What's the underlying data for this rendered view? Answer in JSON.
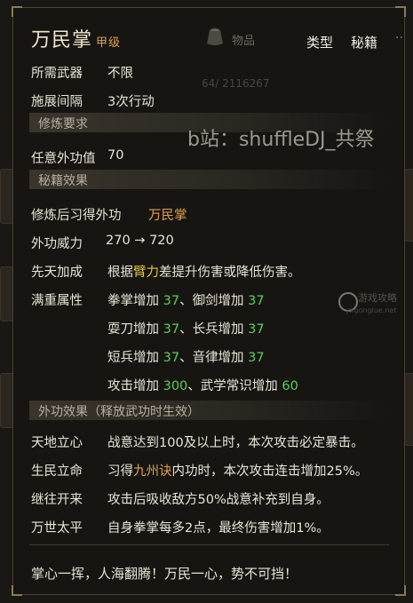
{
  "item": {
    "name": "万民掌",
    "grade": "甲级",
    "type_label": "类型",
    "type_value": "秘籍"
  },
  "background": {
    "bag_label": "物品",
    "bg_number": "64/ 2116267"
  },
  "watermark": "b站：shuffleDJ_共祭",
  "logo_text": "游戏攻略",
  "logo_sub": "yxgonglue.net",
  "basic": {
    "weapon_label": "所需武器",
    "weapon_value": "不限",
    "interval_label": "施展间隔",
    "interval_value": "3次行动"
  },
  "sections": {
    "training": "修炼要求",
    "secret": "秘籍效果",
    "ext_effect": "外功效果（释放武功时生效）"
  },
  "training": {
    "req_label": "任意外功值",
    "req_value": "70"
  },
  "secret": {
    "learn_label": "修炼后习得外功",
    "learn_value": "万民掌",
    "power_label": "外功威力",
    "power_from": "270",
    "arrow": "→",
    "power_to": "720",
    "innate_label": "先天加成",
    "innate_prefix": "根据",
    "innate_attr": "臂力",
    "innate_suffix": "差提升伤害或降低伤害。",
    "full_label": "满重属性",
    "stats": [
      {
        "a_name": "拳掌增加",
        "a_val": "37",
        "sep": "、",
        "b_name": "御剑增加",
        "b_val": "37"
      },
      {
        "a_name": "耍刀增加",
        "a_val": "37",
        "sep": "、",
        "b_name": "长兵增加",
        "b_val": "37"
      },
      {
        "a_name": "短兵增加",
        "a_val": "37",
        "sep": "、",
        "b_name": "音律增加",
        "b_val": "37"
      },
      {
        "a_name": "攻击增加",
        "a_val": "300",
        "sep": "、",
        "b_name": "武学常识增加",
        "b_val": "60"
      }
    ]
  },
  "effects": [
    {
      "name": "天地立心",
      "text": "战意达到100及以上时，本次攻击必定暴击。"
    },
    {
      "name": "生民立命",
      "prefix": "习得",
      "highlight": "九州诀",
      "suffix": "内功时，本次攻击连击增加25%。"
    },
    {
      "name": "继往开来",
      "text": "攻击后吸收敌方50%战意补充到自身。"
    },
    {
      "name": "万世太平",
      "text": "自身拳掌每多2点，最终伤害增加1%。"
    }
  ],
  "quote": "掌心一挥，人海翻腾！万民一心，势不可挡！",
  "colors": {
    "attr_highlight": "#e2c83a",
    "value_green": "#5ccf52",
    "skill_orange": "#e0a24a"
  }
}
